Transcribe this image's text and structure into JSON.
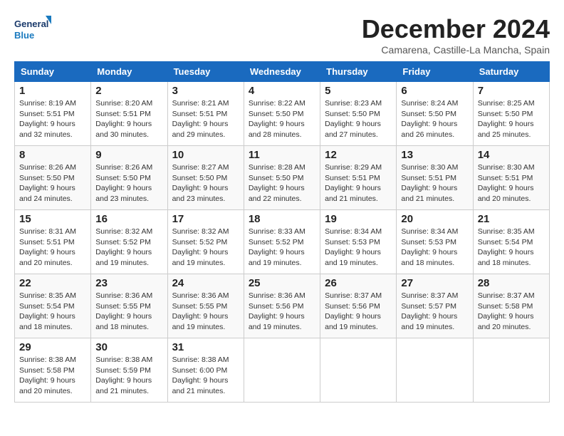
{
  "logo": {
    "general": "General",
    "blue": "Blue"
  },
  "title": "December 2024",
  "location": "Camarena, Castille-La Mancha, Spain",
  "days_of_week": [
    "Sunday",
    "Monday",
    "Tuesday",
    "Wednesday",
    "Thursday",
    "Friday",
    "Saturday"
  ],
  "weeks": [
    [
      {
        "day": "1",
        "info": "Sunrise: 8:19 AM\nSunset: 5:51 PM\nDaylight: 9 hours\nand 32 minutes."
      },
      {
        "day": "2",
        "info": "Sunrise: 8:20 AM\nSunset: 5:51 PM\nDaylight: 9 hours\nand 30 minutes."
      },
      {
        "day": "3",
        "info": "Sunrise: 8:21 AM\nSunset: 5:51 PM\nDaylight: 9 hours\nand 29 minutes."
      },
      {
        "day": "4",
        "info": "Sunrise: 8:22 AM\nSunset: 5:50 PM\nDaylight: 9 hours\nand 28 minutes."
      },
      {
        "day": "5",
        "info": "Sunrise: 8:23 AM\nSunset: 5:50 PM\nDaylight: 9 hours\nand 27 minutes."
      },
      {
        "day": "6",
        "info": "Sunrise: 8:24 AM\nSunset: 5:50 PM\nDaylight: 9 hours\nand 26 minutes."
      },
      {
        "day": "7",
        "info": "Sunrise: 8:25 AM\nSunset: 5:50 PM\nDaylight: 9 hours\nand 25 minutes."
      }
    ],
    [
      {
        "day": "8",
        "info": "Sunrise: 8:26 AM\nSunset: 5:50 PM\nDaylight: 9 hours\nand 24 minutes."
      },
      {
        "day": "9",
        "info": "Sunrise: 8:26 AM\nSunset: 5:50 PM\nDaylight: 9 hours\nand 23 minutes."
      },
      {
        "day": "10",
        "info": "Sunrise: 8:27 AM\nSunset: 5:50 PM\nDaylight: 9 hours\nand 23 minutes."
      },
      {
        "day": "11",
        "info": "Sunrise: 8:28 AM\nSunset: 5:50 PM\nDaylight: 9 hours\nand 22 minutes."
      },
      {
        "day": "12",
        "info": "Sunrise: 8:29 AM\nSunset: 5:51 PM\nDaylight: 9 hours\nand 21 minutes."
      },
      {
        "day": "13",
        "info": "Sunrise: 8:30 AM\nSunset: 5:51 PM\nDaylight: 9 hours\nand 21 minutes."
      },
      {
        "day": "14",
        "info": "Sunrise: 8:30 AM\nSunset: 5:51 PM\nDaylight: 9 hours\nand 20 minutes."
      }
    ],
    [
      {
        "day": "15",
        "info": "Sunrise: 8:31 AM\nSunset: 5:51 PM\nDaylight: 9 hours\nand 20 minutes."
      },
      {
        "day": "16",
        "info": "Sunrise: 8:32 AM\nSunset: 5:52 PM\nDaylight: 9 hours\nand 19 minutes."
      },
      {
        "day": "17",
        "info": "Sunrise: 8:32 AM\nSunset: 5:52 PM\nDaylight: 9 hours\nand 19 minutes."
      },
      {
        "day": "18",
        "info": "Sunrise: 8:33 AM\nSunset: 5:52 PM\nDaylight: 9 hours\nand 19 minutes."
      },
      {
        "day": "19",
        "info": "Sunrise: 8:34 AM\nSunset: 5:53 PM\nDaylight: 9 hours\nand 19 minutes."
      },
      {
        "day": "20",
        "info": "Sunrise: 8:34 AM\nSunset: 5:53 PM\nDaylight: 9 hours\nand 18 minutes."
      },
      {
        "day": "21",
        "info": "Sunrise: 8:35 AM\nSunset: 5:54 PM\nDaylight: 9 hours\nand 18 minutes."
      }
    ],
    [
      {
        "day": "22",
        "info": "Sunrise: 8:35 AM\nSunset: 5:54 PM\nDaylight: 9 hours\nand 18 minutes."
      },
      {
        "day": "23",
        "info": "Sunrise: 8:36 AM\nSunset: 5:55 PM\nDaylight: 9 hours\nand 18 minutes."
      },
      {
        "day": "24",
        "info": "Sunrise: 8:36 AM\nSunset: 5:55 PM\nDaylight: 9 hours\nand 19 minutes."
      },
      {
        "day": "25",
        "info": "Sunrise: 8:36 AM\nSunset: 5:56 PM\nDaylight: 9 hours\nand 19 minutes."
      },
      {
        "day": "26",
        "info": "Sunrise: 8:37 AM\nSunset: 5:56 PM\nDaylight: 9 hours\nand 19 minutes."
      },
      {
        "day": "27",
        "info": "Sunrise: 8:37 AM\nSunset: 5:57 PM\nDaylight: 9 hours\nand 19 minutes."
      },
      {
        "day": "28",
        "info": "Sunrise: 8:37 AM\nSunset: 5:58 PM\nDaylight: 9 hours\nand 20 minutes."
      }
    ],
    [
      {
        "day": "29",
        "info": "Sunrise: 8:38 AM\nSunset: 5:58 PM\nDaylight: 9 hours\nand 20 minutes."
      },
      {
        "day": "30",
        "info": "Sunrise: 8:38 AM\nSunset: 5:59 PM\nDaylight: 9 hours\nand 21 minutes."
      },
      {
        "day": "31",
        "info": "Sunrise: 8:38 AM\nSunset: 6:00 PM\nDaylight: 9 hours\nand 21 minutes."
      },
      null,
      null,
      null,
      null
    ]
  ]
}
